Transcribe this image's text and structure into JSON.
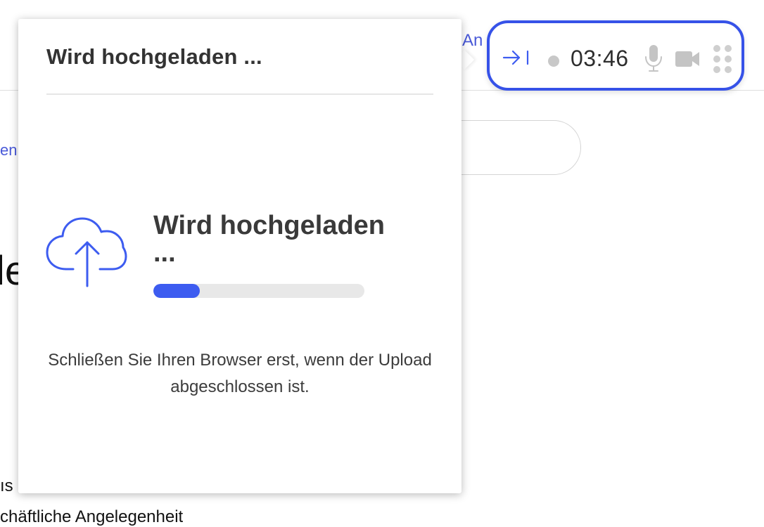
{
  "background": {
    "top_link": "An",
    "left_link": "en",
    "heading_fragment": "le",
    "text_fragment_1": "ıs",
    "text_fragment_2": "chäftliche Angelegenheit"
  },
  "upload_popover": {
    "title": "Wird hochgeladen ...",
    "status": "Wird hochgeladen ...",
    "progress_fraction": 0.22,
    "note": "Schließen Sie Ihren Browser erst, wenn der Upload abgeschlossen ist.",
    "icon": "cloud-upload-icon"
  },
  "recording_toolbar": {
    "timer": "03:46",
    "icons": [
      "collapse-arrow-icon",
      "record-dot-icon",
      "microphone-icon",
      "camera-icon",
      "drag-handle-icon"
    ]
  },
  "colors": {
    "accent": "#3652e8",
    "progress": "#3d5cf0",
    "muted_icon": "#c4c4c4"
  }
}
